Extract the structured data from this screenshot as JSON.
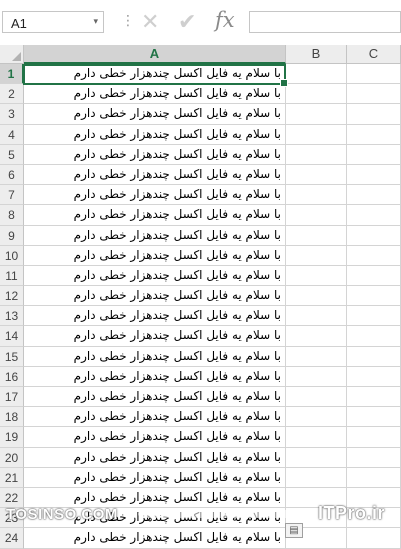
{
  "formula_bar": {
    "name_box": "A1",
    "name_box_arrow": "▾",
    "separator": "⋮",
    "cancel_symbol": "✕",
    "enter_symbol": "✔",
    "fx_label": "fx",
    "formula_value": ""
  },
  "columns": [
    "A",
    "B",
    "C"
  ],
  "active_cell": "A1",
  "cell_text": "با سلام یه فایل اکسل چندهزار خطی دارم",
  "rows": [
    {
      "num": "1",
      "a": "با سلام یه فایل اکسل چندهزار خطی دارم"
    },
    {
      "num": "2",
      "a": "با سلام یه فایل اکسل چندهزار خطی دارم"
    },
    {
      "num": "3",
      "a": "با سلام یه فایل اکسل چندهزار خطی دارم"
    },
    {
      "num": "4",
      "a": "با سلام یه فایل اکسل چندهزار خطی دارم"
    },
    {
      "num": "5",
      "a": "با سلام یه فایل اکسل چندهزار خطی دارم"
    },
    {
      "num": "6",
      "a": "با سلام یه فایل اکسل چندهزار خطی دارم"
    },
    {
      "num": "7",
      "a": "با سلام یه فایل اکسل چندهزار خطی دارم"
    },
    {
      "num": "8",
      "a": "با سلام یه فایل اکسل چندهزار خطی دارم"
    },
    {
      "num": "9",
      "a": "با سلام یه فایل اکسل چندهزار خطی دارم"
    },
    {
      "num": "10",
      "a": "با سلام یه فایل اکسل چندهزار خطی دارم"
    },
    {
      "num": "11",
      "a": "با سلام یه فایل اکسل چندهزار خطی دارم"
    },
    {
      "num": "12",
      "a": "با سلام یه فایل اکسل چندهزار خطی دارم"
    },
    {
      "num": "13",
      "a": "با سلام یه فایل اکسل چندهزار خطی دارم"
    },
    {
      "num": "14",
      "a": "با سلام یه فایل اکسل چندهزار خطی دارم"
    },
    {
      "num": "15",
      "a": "با سلام یه فایل اکسل چندهزار خطی دارم"
    },
    {
      "num": "16",
      "a": "با سلام یه فایل اکسل چندهزار خطی دارم"
    },
    {
      "num": "17",
      "a": "با سلام یه فایل اکسل چندهزار خطی دارم"
    },
    {
      "num": "18",
      "a": "با سلام یه فایل اکسل چندهزار خطی دارم"
    },
    {
      "num": "19",
      "a": "با سلام یه فایل اکسل چندهزار خطی دارم"
    },
    {
      "num": "20",
      "a": "با سلام یه فایل اکسل چندهزار خطی دارم"
    },
    {
      "num": "21",
      "a": "با سلام یه فایل اکسل چندهزار خطی دارم"
    },
    {
      "num": "22",
      "a": "با سلام یه فایل اکسل چندهزار خطی دارم"
    },
    {
      "num": "23",
      "a": "با سلام یه فایل اکسل چندهزار خطی دارم"
    },
    {
      "num": "24",
      "a": "با سلام یه فایل اکسل چندهزار خطی دارم"
    }
  ],
  "paste_options_icon": "paste-options-icon",
  "watermark": {
    "left": "TOSINSO.COM",
    "right": "ITPro.ir"
  },
  "colors": {
    "accent": "#217346",
    "header_bg": "#ededed",
    "header_selected_bg": "#d3d3d3",
    "gridline": "#d4d4d4"
  }
}
